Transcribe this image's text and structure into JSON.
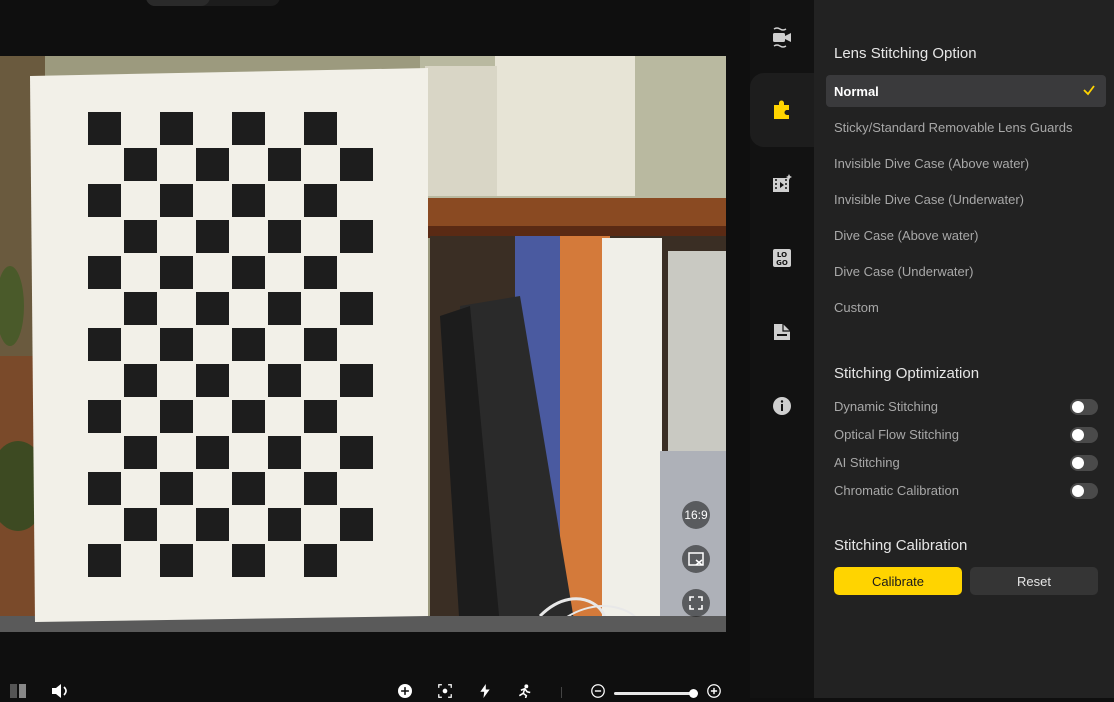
{
  "preview": {
    "aspect_label": "16:9"
  },
  "rail": {
    "items": [
      {
        "icon": "video-stabilization-icon"
      },
      {
        "icon": "puzzle-icon",
        "active": true
      },
      {
        "icon": "video-effects-icon"
      },
      {
        "icon": "logo-icon"
      },
      {
        "icon": "file-icon"
      },
      {
        "icon": "info-icon"
      }
    ]
  },
  "panel": {
    "lens_stitching": {
      "title": "Lens Stitching Option",
      "options": [
        "Normal",
        "Sticky/Standard Removable Lens Guards",
        "Invisible Dive Case (Above water)",
        "Invisible Dive Case (Underwater)",
        "Dive Case (Above water)",
        "Dive Case (Underwater)",
        "Custom"
      ],
      "selected": "Normal"
    },
    "optimization": {
      "title": "Stitching Optimization",
      "toggles": [
        {
          "label": "Dynamic Stitching",
          "on": false
        },
        {
          "label": "Optical Flow Stitching",
          "on": false
        },
        {
          "label": "AI Stitching",
          "on": false
        },
        {
          "label": "Chromatic Calibration",
          "on": false
        }
      ]
    },
    "calibration": {
      "title": "Stitching Calibration",
      "calibrate_label": "Calibrate",
      "reset_label": "Reset"
    }
  },
  "colors": {
    "accent": "#ffd400",
    "panel_bg": "#222222",
    "selected_bg": "#3a3a3c"
  }
}
